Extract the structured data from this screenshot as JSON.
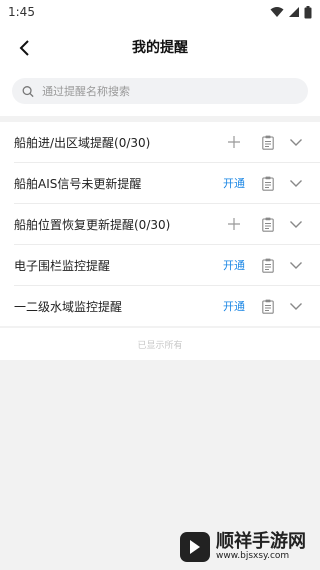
{
  "status_bar": {
    "time": "1:45"
  },
  "header": {
    "title": "我的提醒",
    "back_icon": "back-arrow-icon"
  },
  "search": {
    "placeholder": "通过提醒名称搜索",
    "value": ""
  },
  "reminders": [
    {
      "label": "船舶进/出区域提醒(0/30)",
      "action": "add",
      "action_icon": "plus-icon"
    },
    {
      "label": "船舶AIS信号未更新提醒",
      "action": "open",
      "action_label": "开通"
    },
    {
      "label": "船舶位置恢复更新提醒(0/30)",
      "action": "add",
      "action_icon": "plus-icon"
    },
    {
      "label": "电子围栏监控提醒",
      "action": "open",
      "action_label": "开通"
    },
    {
      "label": "一二级水域监控提醒",
      "action": "open",
      "action_label": "开通"
    }
  ],
  "list_footer": "已显示所有",
  "watermark": {
    "title": "顺祥手游网",
    "url": "www.bjsxsy.com"
  },
  "colors": {
    "accent": "#1e88e5",
    "background": "#f2f2f2"
  }
}
